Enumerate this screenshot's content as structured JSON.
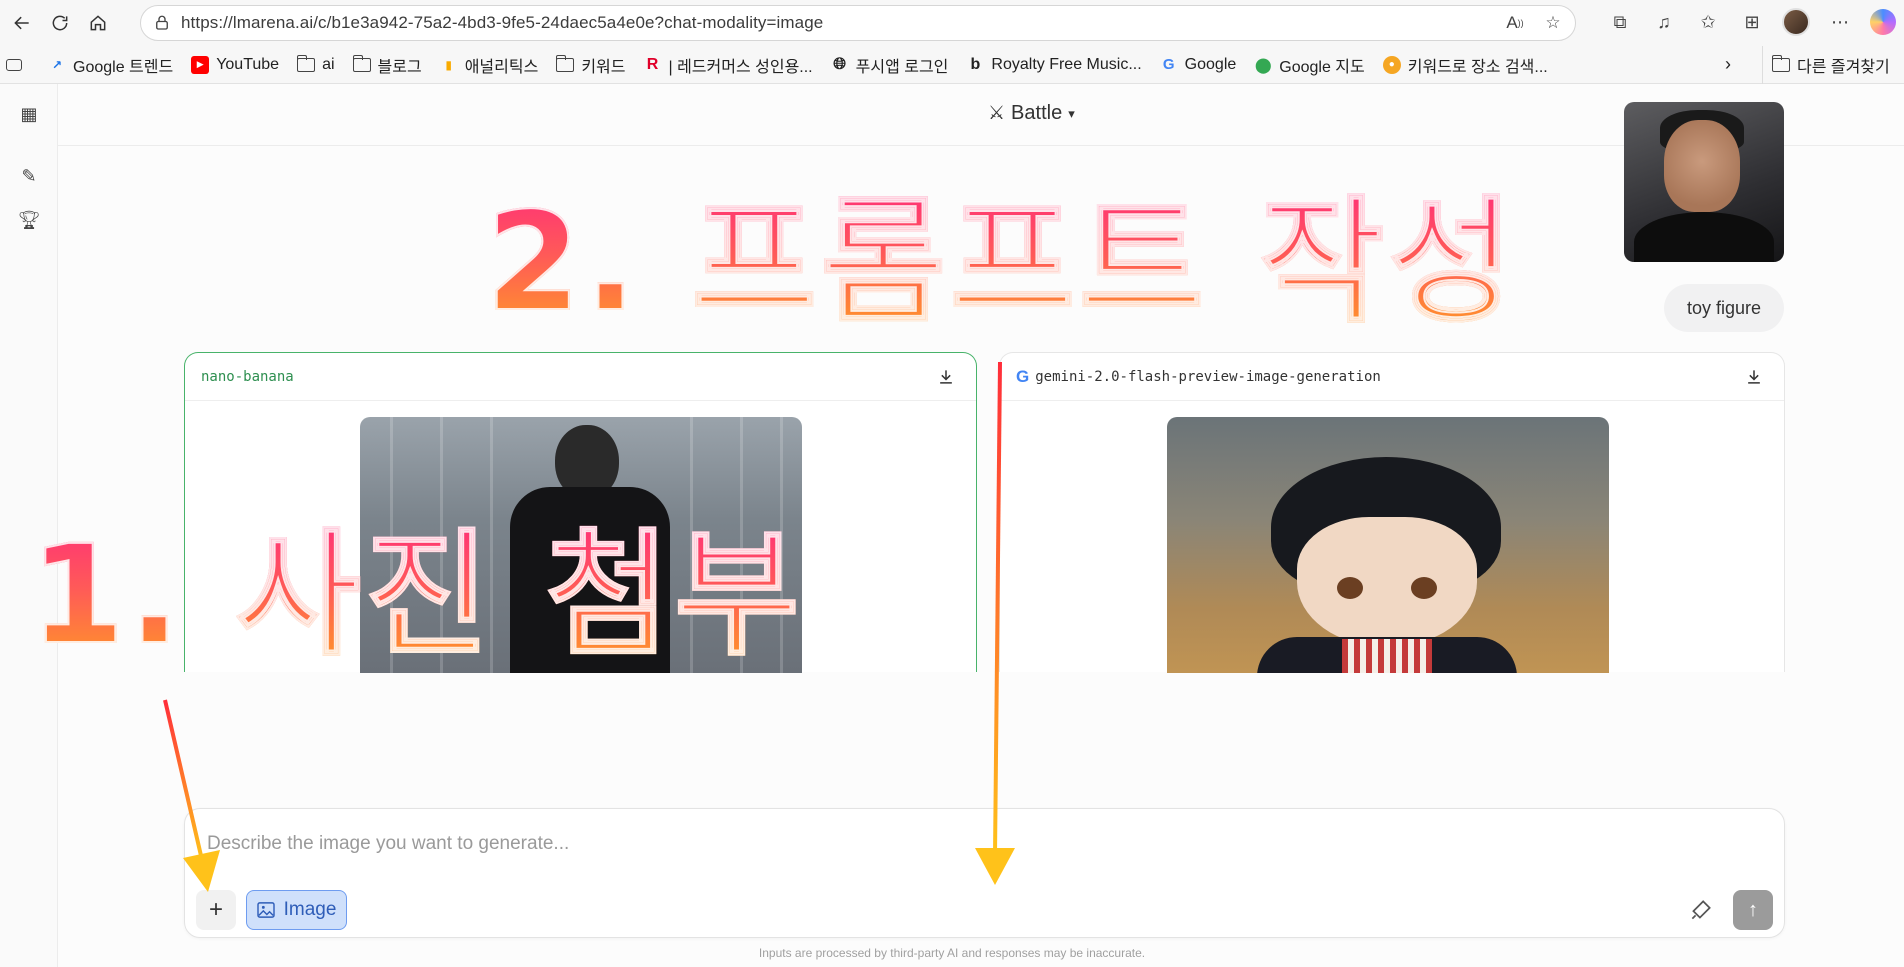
{
  "browser": {
    "url": "https://lmarena.ai/c/b1e3a942-75a2-4bd3-9fe5-24daec5a4e0e?chat-modality=image",
    "bookmarks": [
      {
        "label": "Google 트렌드",
        "icon": "trends-icon"
      },
      {
        "label": "YouTube",
        "icon": "youtube-icon"
      },
      {
        "label": "ai",
        "icon": "folder-icon"
      },
      {
        "label": "블로그",
        "icon": "folder-icon"
      },
      {
        "label": "애널리틱스",
        "icon": "analytics-icon"
      },
      {
        "label": "키워드",
        "icon": "folder-icon"
      },
      {
        "label": "| 레드커머스 성인용...",
        "icon": "r-icon"
      },
      {
        "label": "푸시앱 로그인",
        "icon": "globe-icon"
      },
      {
        "label": "Royalty Free Music...",
        "icon": "b-icon"
      },
      {
        "label": "Google",
        "icon": "google-icon"
      },
      {
        "label": "Google 지도",
        "icon": "maps-icon"
      },
      {
        "label": "키워드로 장소 검색...",
        "icon": "cat-icon"
      }
    ],
    "other_bookmarks": "다른 즐겨찾기"
  },
  "app": {
    "mode_label": "Battle",
    "user_message": "toy figure",
    "left_model": "nano-banana",
    "right_model": "gemini-2.0-flash-preview-image-generation",
    "composer_placeholder": "Describe the image you want to generate...",
    "image_button_label": "Image",
    "disclaimer": "Inputs are processed by third-party AI and responses may be inaccurate."
  },
  "annotations": {
    "step1": "1. 사진 첨부",
    "step2": "2. 프롬프트 작성"
  },
  "colors": {
    "accent_green": "#2e8f50",
    "image_button_bg": "#cfe0fb",
    "annotation_pink": "#ff2d7a",
    "annotation_orange": "#ffa020"
  }
}
